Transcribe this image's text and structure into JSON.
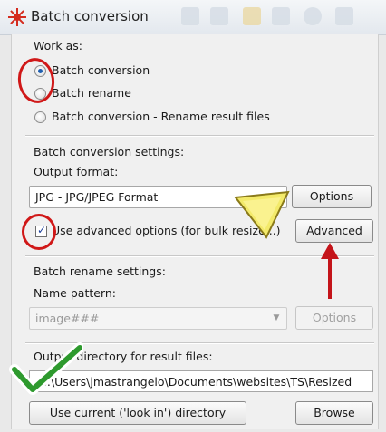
{
  "window": {
    "title": "Batch conversion"
  },
  "work_as": {
    "heading": "Work as:",
    "options": [
      {
        "label": "Batch conversion",
        "selected": true
      },
      {
        "label": "Batch rename",
        "selected": false
      },
      {
        "label": "Batch conversion - Rename result files",
        "selected": false
      }
    ]
  },
  "conversion": {
    "heading": "Batch conversion settings:",
    "output_format_label": "Output format:",
    "output_format_value": "JPG - JPG/JPEG Format",
    "options_button": "Options",
    "advanced_checkbox_label": "Use advanced options (for bulk resize...)",
    "advanced_checked": true,
    "advanced_button": "Advanced"
  },
  "rename": {
    "heading": "Batch rename settings:",
    "name_pattern_label": "Name pattern:",
    "name_pattern_value": "image###",
    "options_button": "Options"
  },
  "output": {
    "heading": "Output directory for result files:",
    "path": "C:\\Users\\jmastrangelo\\Documents\\websites\\TS\\Resized",
    "use_current_button": "Use current ('look in') directory",
    "browse_button": "Browse"
  },
  "colors": {
    "annotation_red": "#d01818",
    "annotation_green": "#2e9a2e",
    "annotation_yellow": "#f3ea6a",
    "radio_dot": "#1f5fb0"
  }
}
